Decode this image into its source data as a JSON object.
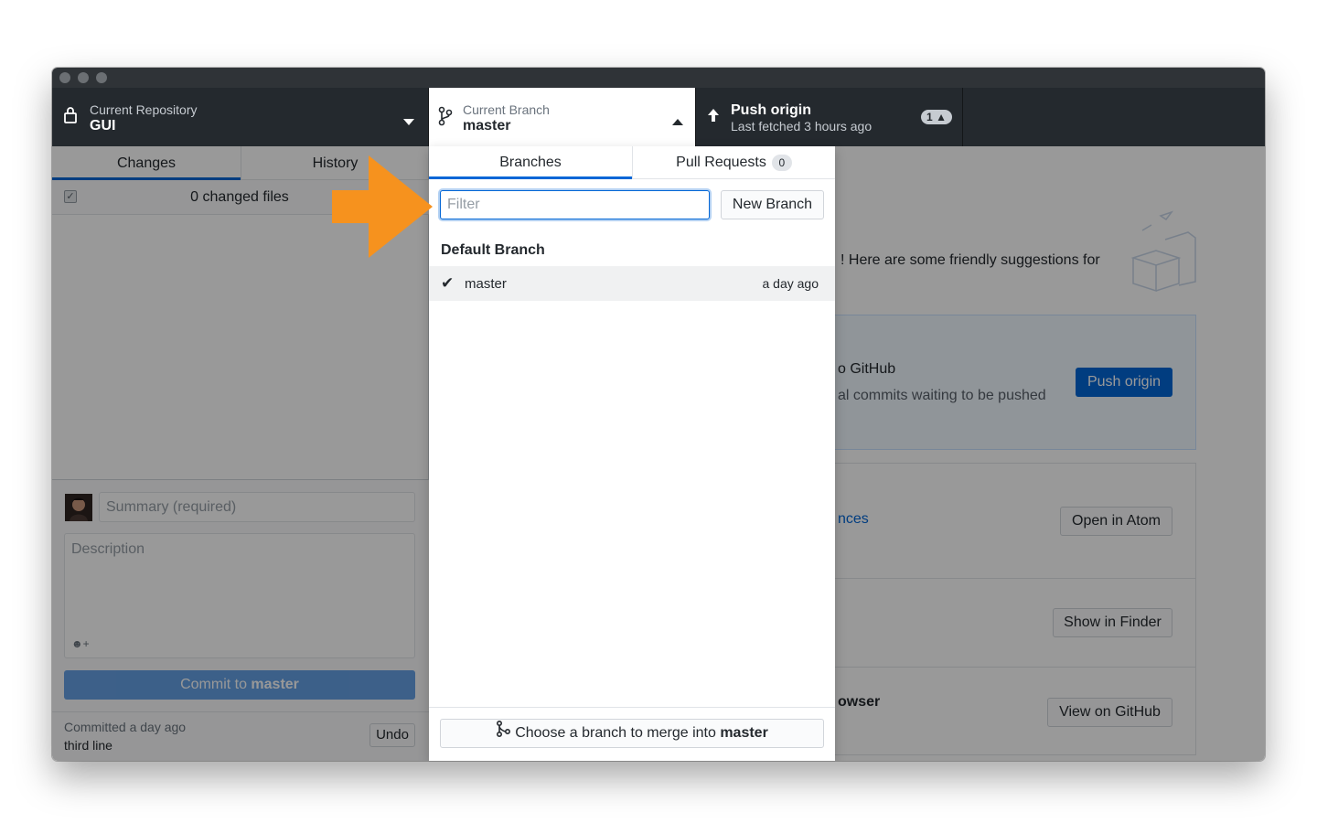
{
  "toolbar": {
    "repository": {
      "label": "Current Repository",
      "value": "GUI"
    },
    "branch": {
      "label": "Current Branch",
      "value": "master"
    },
    "push": {
      "title": "Push origin",
      "subtitle": "Last fetched 3 hours ago",
      "badge": "1"
    }
  },
  "left": {
    "tabs": [
      {
        "label": "Changes"
      },
      {
        "label": "History"
      }
    ],
    "changed_files": "0 changed files",
    "summary_placeholder": "Summary (required)",
    "description_placeholder": "Description",
    "commit_prefix": "Commit to ",
    "commit_branch": "master",
    "last_commit_time": "Committed a day ago",
    "last_commit_message": "third line",
    "undo_label": "Undo"
  },
  "right": {
    "suggestion_text": "! Here are some friendly suggestions for",
    "push_card_title": "o GitHub",
    "push_card_subtitle": "al commits waiting to be pushed",
    "push_button": "Push origin",
    "editor_link": "nces",
    "open_atom": "Open in Atom",
    "show_finder": "Show in Finder",
    "browser_text": "owser",
    "view_github": "View on GitHub"
  },
  "dropdown": {
    "tabs": [
      {
        "label": "Branches"
      },
      {
        "label": "Pull Requests",
        "count": "0"
      }
    ],
    "filter_placeholder": "Filter",
    "new_branch": "New Branch",
    "section_title": "Default Branch",
    "branches": [
      {
        "name": "master",
        "time": "a day ago",
        "current": true
      }
    ],
    "merge_prefix": "Choose a branch to merge into ",
    "merge_branch": "master"
  },
  "colors": {
    "accent": "#0366d6",
    "toolbar_bg": "#24292e",
    "arrow": "#f6921e"
  }
}
